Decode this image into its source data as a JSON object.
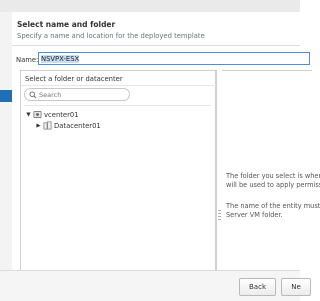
{
  "header": {
    "title": "Select name and folder",
    "subtitle": "Specify a name and location for the deployed template"
  },
  "name_field": {
    "label": "Name:",
    "value": "NSVPX-ESX"
  },
  "folder_panel": {
    "title": "Select a folder or datacenter",
    "search_placeholder": "Search",
    "tree": [
      {
        "label": "vcenter01",
        "expanded": true,
        "icon": "vcenter-icon"
      },
      {
        "label": "Datacenter01",
        "expanded": false,
        "icon": "datacenter-icon"
      }
    ]
  },
  "info_panel": {
    "lines_1": [
      "The folder you select is wher",
      "will be used to apply permiss"
    ],
    "lines_2": [
      "The name of the entity must b",
      "Server VM folder."
    ]
  },
  "footer": {
    "back_label": "Back",
    "next_label": "Ne"
  },
  "colors": {
    "accent": "#1f6fb5",
    "input_focus_border": "#4a90d9"
  }
}
